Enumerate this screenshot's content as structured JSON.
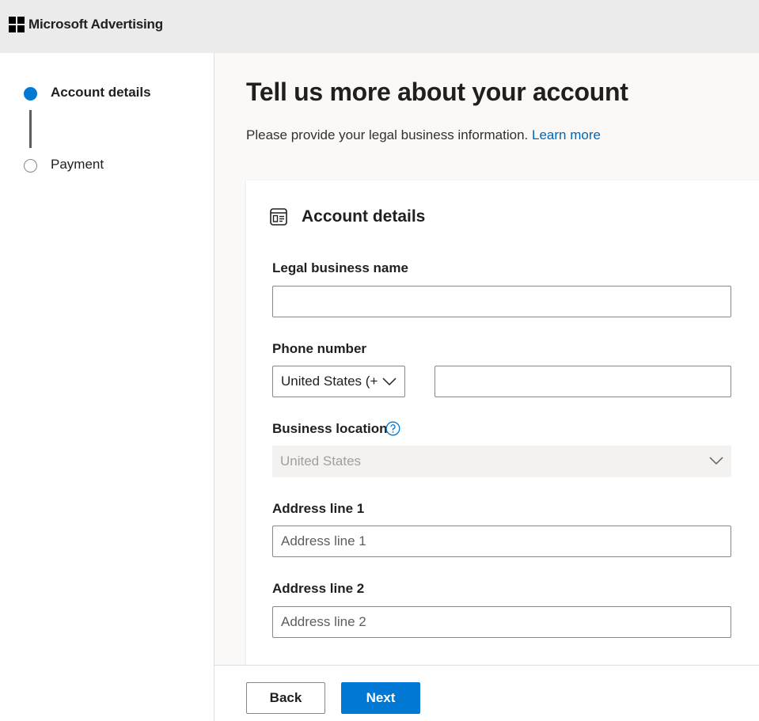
{
  "header": {
    "brand": "Microsoft Advertising",
    "icon": "microsoft-logo"
  },
  "steps": [
    {
      "label": "Account details",
      "state": "active"
    },
    {
      "label": "Payment",
      "state": "inactive"
    }
  ],
  "page": {
    "title": "Tell us more about your account",
    "subtitle": "Please provide your legal business information.",
    "learn_more": "Learn more"
  },
  "card": {
    "title": "Account details",
    "icon": "form-icon"
  },
  "form": {
    "legal_name": {
      "label": "Legal business name",
      "value": "",
      "placeholder": ""
    },
    "phone": {
      "label": "Phone number",
      "country": "United States (+",
      "value": "",
      "placeholder": ""
    },
    "business_location": {
      "label": "Business location",
      "value": "United States",
      "help_icon": "question-circle-icon"
    },
    "address1": {
      "label": "Address line 1",
      "value": "",
      "placeholder": "Address line 1"
    },
    "address2": {
      "label": "Address line 2",
      "value": "",
      "placeholder": "Address line 2"
    }
  },
  "footer": {
    "back": "Back",
    "next": "Next"
  },
  "colors": {
    "accent": "#0078d4",
    "link": "#0067b8",
    "topbar": "#ebebeb",
    "disabled_bg": "#f3f2f1"
  }
}
